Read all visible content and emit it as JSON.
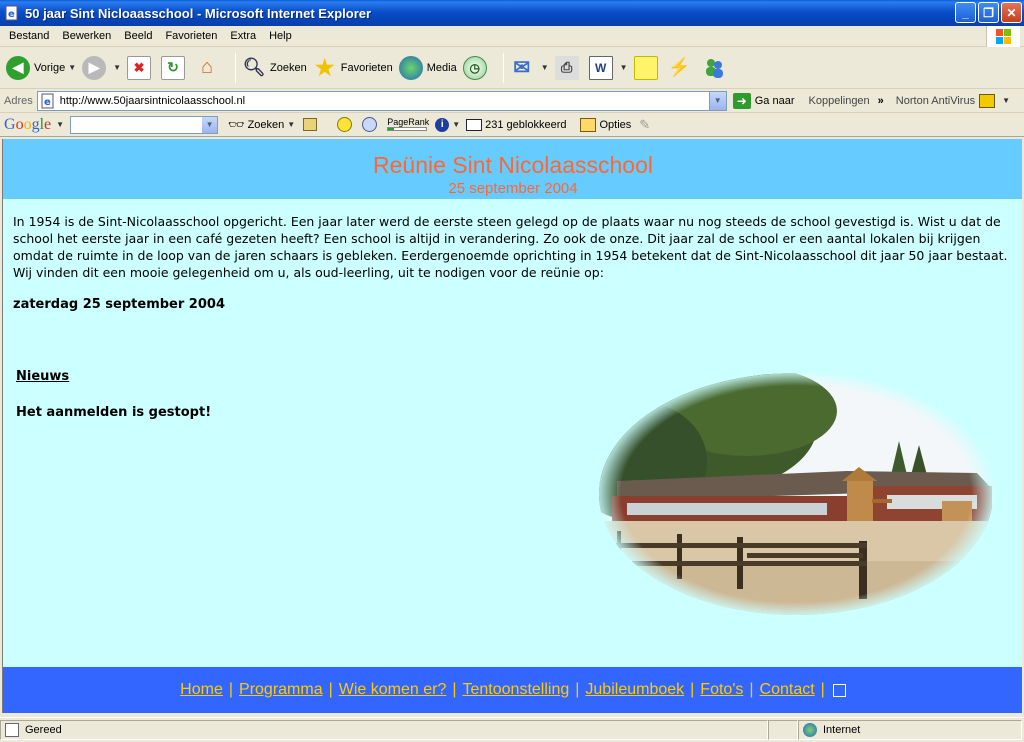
{
  "window": {
    "title": "50 jaar Sint Nicloaasschool - Microsoft Internet Explorer"
  },
  "menu": [
    "Bestand",
    "Bewerken",
    "Beeld",
    "Favorieten",
    "Extra",
    "Help"
  ],
  "toolbar": {
    "back": "Vorige",
    "search": "Zoeken",
    "favorites": "Favorieten",
    "media": "Media"
  },
  "address": {
    "label": "Adres",
    "url": "http://www.50jaarsintnicolaasschool.nl",
    "go": "Ga naar",
    "links": "Koppelingen",
    "norton": "Norton AntiVirus"
  },
  "google_bar": {
    "logo": "Google",
    "search": "Zoeken",
    "pagerank": "PageRank",
    "blocked": "231 geblokkeerd",
    "options": "Opties"
  },
  "page": {
    "title": "Reünie Sint Nicolaasschool",
    "subtitle": "25 september 2004",
    "intro": "In 1954 is de Sint-Nicolaasschool opgericht. Een jaar later werd de eerste steen gelegd op de plaats waar nu nog steeds de school gevestigd is. Wist u dat de school het eerste jaar in een café gezeten heeft? Een school is altijd in verandering. Zo ook de onze. Dit jaar zal de school er een aantal lokalen bij krijgen omdat de ruimte in de loop van de jaren schaars is gebleken. Eerdergenoemde oprichting in 1954 betekent dat de Sint-Nicolaasschool dit jaar 50 jaar bestaat. Wij vinden dit een mooie gelegenheid om u, als oud-leerling, uit te nodigen voor de reünie op:",
    "date_bold": "zaterdag 25 september 2004",
    "news_heading": "Nieuws",
    "news_text": "Het aanmelden is gestopt!",
    "nav": [
      "Home",
      "Programma",
      "Wie komen er?",
      "Tentoonstelling",
      "Jubileumboek",
      "Foto's",
      "Contact"
    ]
  },
  "status": {
    "left": "Gereed",
    "zone": "Internet"
  },
  "colors": {
    "page_bg": "#ccffff",
    "header_bg": "#66ccff",
    "title": "#ff6633",
    "footer_bg": "#3366ff",
    "nav_link": "#ffcc00"
  }
}
